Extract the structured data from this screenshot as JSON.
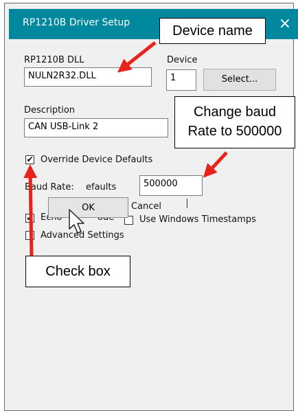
{
  "window": {
    "title": "RP1210B Driver Setup",
    "close_glyph": "×"
  },
  "dll": {
    "label": "RP1210B DLL",
    "value": "NULN2R32.DLL"
  },
  "device": {
    "label": "Device",
    "value": "1",
    "select_label": "Select..."
  },
  "description": {
    "label": "Description",
    "value": "CAN USB-Link 2"
  },
  "override": {
    "label": "Override Device Defaults",
    "checked": true
  },
  "baud": {
    "label": "Baud Rate:",
    "value": "500000"
  },
  "overlay_fragments": {
    "defaults_fragment": "efaults",
    "cancel_fragment": "Cancel",
    "echo_fragment": "Echo",
    "echo_tail": "ode"
  },
  "popup": {
    "ok_label": "OK"
  },
  "timestamps": {
    "label": "Use Windows Timestamps"
  },
  "advanced": {
    "label": "Advanced Settings"
  },
  "annotations": {
    "device_name": "Device name",
    "change_baud_line1": "Change baud",
    "change_baud_line2": "Rate to 500000",
    "check_box": "Check box",
    "arrow_color": "#e8231c"
  }
}
